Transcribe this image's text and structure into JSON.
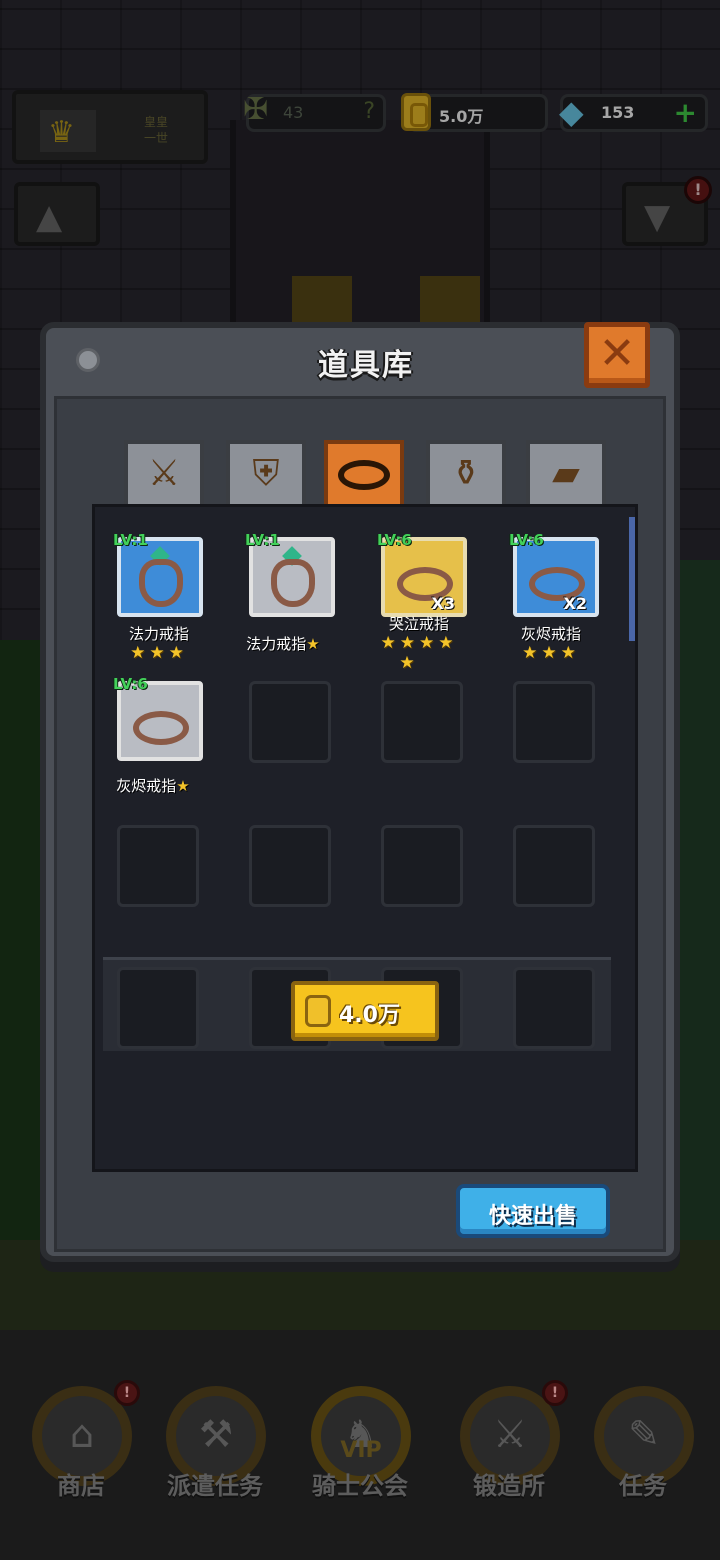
{
  "hud": {
    "rank_value": "43",
    "rank_help": "?",
    "gold": "5.0万",
    "gems": "153",
    "gem_add": "+",
    "crown_label": "皇皇\n一世",
    "notify": "!"
  },
  "dialog": {
    "title": "道具库",
    "close_glyph": "✕",
    "tabs": [
      {
        "name": "weapon",
        "icon": "sword-icon"
      },
      {
        "name": "armor",
        "icon": "armor-icon"
      },
      {
        "name": "ring",
        "icon": "ring-icon",
        "active": true
      },
      {
        "name": "potion",
        "icon": "potion-icon"
      },
      {
        "name": "material",
        "icon": "wood-icon"
      }
    ],
    "items": [
      {
        "level": "LV:1",
        "name": "法力戒指",
        "stars": "★★★",
        "rarity": "blue",
        "qty": ""
      },
      {
        "level": "LV:1",
        "name": "法力戒指",
        "stars": "★",
        "rarity": "gray",
        "qty": ""
      },
      {
        "level": "LV:6",
        "name": "哭泣戒指",
        "stars": "★★★★",
        "stars_extra": "★",
        "rarity": "gold",
        "qty": "X3"
      },
      {
        "level": "LV:6",
        "name": "灰烬戒指",
        "stars": "★★★",
        "rarity": "blue",
        "qty": "X2"
      },
      {
        "level": "LV:6",
        "name": "灰烬戒指",
        "stars": "★",
        "rarity": "gray",
        "qty": ""
      }
    ],
    "sell_price": "4.0万",
    "quick_sell_label": "快速出售"
  },
  "nav": {
    "items": [
      {
        "label": "商店",
        "icon": "shop-icon",
        "badge": "!"
      },
      {
        "label": "派遣任务",
        "icon": "dispatch-icon",
        "badge": ""
      },
      {
        "label": "骑士公会",
        "icon": "knight-icon",
        "badge": "",
        "tag": "VIP"
      },
      {
        "label": "锻造所",
        "icon": "anvil-icon",
        "badge": "!"
      },
      {
        "label": "任务",
        "icon": "scroll-icon",
        "badge": ""
      }
    ]
  },
  "colors": {
    "accent_orange": "#e07a2c",
    "level_green": "#43d15a",
    "star_gold": "#f3c32a",
    "quick_sell_blue": "#3fb0e8"
  }
}
